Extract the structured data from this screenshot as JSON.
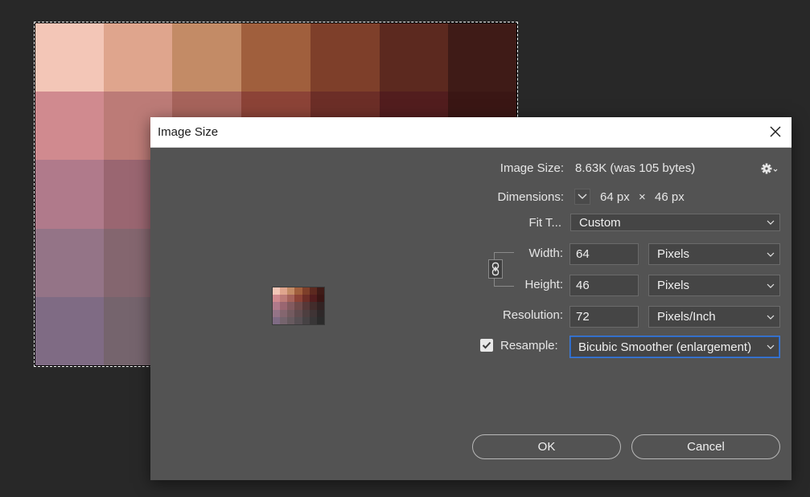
{
  "canvas": {
    "swatches": [
      [
        "#f3c6b7",
        "#dfa58d",
        "#c38b66",
        "#a05f3d",
        "#7e3f2a",
        "#5c291f",
        "#3f1b17"
      ],
      [
        "#d08a8f",
        "#bc7b77",
        "#a6635b",
        "#8c4337",
        "#6c2e27",
        "#521d1e",
        "#3a1614"
      ],
      [
        "#b07a8b",
        "#9a6671",
        "#835a5f",
        "#6f4a4a",
        "#563838",
        "#422c2b",
        "#322323"
      ],
      [
        "#947487",
        "#84666f",
        "#735a5f",
        "#614c4f",
        "#4e3f40",
        "#3f3435",
        "#2e2829"
      ],
      [
        "#7f6b84",
        "#75646d",
        "#675a5f",
        "#574f53",
        "#464244",
        "#383637",
        "#2b2b2b"
      ]
    ]
  },
  "dialog": {
    "title": "Image Size",
    "image_size_label": "Image Size:",
    "image_size_value": "8.63K (was 105 bytes)",
    "dimensions_label": "Dimensions:",
    "dim_width": "64 px",
    "dim_times": "×",
    "dim_height": "46 px",
    "fit_to_label": "Fit T...",
    "fit_to_value": "Custom",
    "width_label": "Width:",
    "width_value": "64",
    "width_unit": "Pixels",
    "height_label": "Height:",
    "height_value": "46",
    "height_unit": "Pixels",
    "resolution_label": "Resolution:",
    "resolution_value": "72",
    "resolution_unit": "Pixels/Inch",
    "resample_label": "Resample:",
    "resample_checked": true,
    "resample_value": "Bicubic Smoother (enlargement)",
    "ok_label": "OK",
    "cancel_label": "Cancel"
  },
  "icons": {
    "close": "close-icon",
    "gear": "gear-icon",
    "chevron": "chevron-down-icon",
    "link": "chain-link-icon",
    "check": "checkmark-icon"
  },
  "colors": {
    "dialog_bg": "#535353",
    "field_bg": "#454545",
    "focus_border": "#3b7ad9",
    "app_bg": "#282828"
  }
}
